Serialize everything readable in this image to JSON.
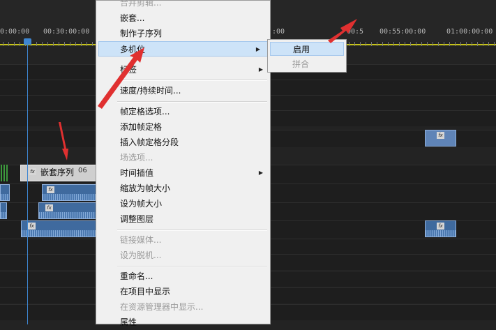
{
  "timeline": {
    "timecodes": [
      "0:00:00",
      "00:30:00:00",
      ":00",
      "00:5",
      "00:55:00:00",
      "01:00:00:00"
    ],
    "nested_clip_label": "嵌套序列",
    "nested_clip_number": "06",
    "fx_label": "fx",
    "track_highlight_color": "#c7c419",
    "playhead_color": "#3e86d1",
    "clip_color": "#5f84b7"
  },
  "context_menu": {
    "items": [
      {
        "label": "合并剪辑...",
        "disabled": true
      },
      {
        "label": "嵌套..."
      },
      {
        "label": "制作子序列"
      },
      {
        "label": "多机位",
        "has_submenu": true,
        "highlighted": true
      },
      {
        "label": "标签",
        "has_submenu": true
      },
      {
        "label": "速度/持续时间..."
      },
      {
        "label": "帧定格选项..."
      },
      {
        "label": "添加帧定格"
      },
      {
        "label": "插入帧定格分段"
      },
      {
        "label": "场选项...",
        "disabled": true
      },
      {
        "label": "时间插值",
        "has_submenu": true
      },
      {
        "label": "缩放为帧大小"
      },
      {
        "label": "设为帧大小"
      },
      {
        "label": "调整图层"
      },
      {
        "label": "链接媒体...",
        "disabled": true
      },
      {
        "label": "设为脱机...",
        "disabled": true
      },
      {
        "label": "重命名..."
      },
      {
        "label": "在项目中显示"
      },
      {
        "label": "在资源管理器中显示...",
        "disabled": true
      },
      {
        "label": "属性"
      }
    ],
    "arrow_glyph": "▶"
  },
  "submenu": {
    "items": [
      {
        "label": "启用",
        "highlighted": true
      },
      {
        "label": "拼合",
        "disabled": true
      }
    ]
  },
  "annotation_color": "#e03030"
}
